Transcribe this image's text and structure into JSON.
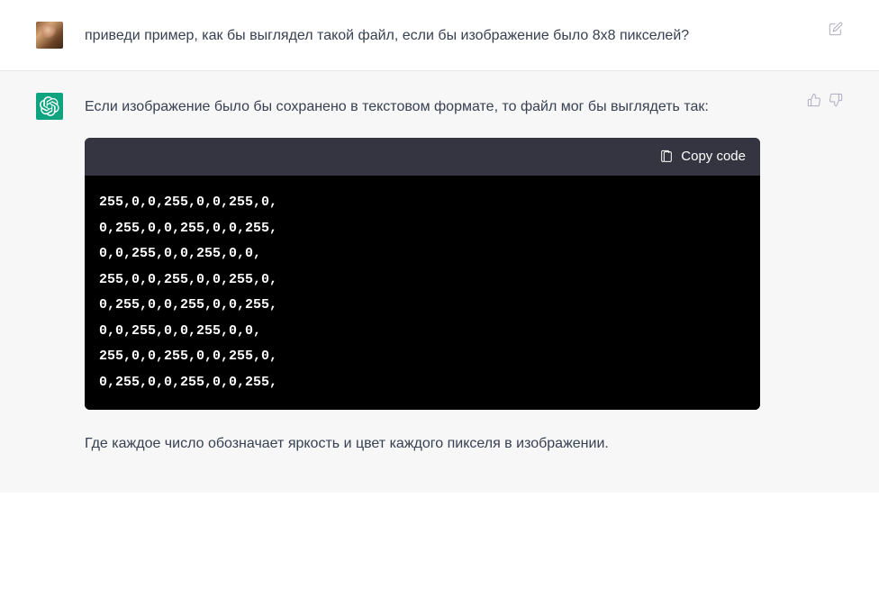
{
  "user_message": {
    "text": "приведи пример, как бы выглядел такой файл, если бы изображение было 8х8 пикселей?"
  },
  "assistant_message": {
    "intro_text": "Если изображение было бы сохранено в текстовом формате, то файл мог бы выглядеть так:",
    "copy_label": "Copy code",
    "code_lines": [
      "255,0,0,255,0,0,255,0,",
      "0,255,0,0,255,0,0,255,",
      "0,0,255,0,0,255,0,0,",
      "255,0,0,255,0,0,255,0,",
      "0,255,0,0,255,0,0,255,",
      "0,0,255,0,0,255,0,0,",
      "255,0,0,255,0,0,255,0,",
      "0,255,0,0,255,0,0,255,"
    ],
    "outro_text": "Где каждое число обозначает яркость и цвет каждого пикселя в изображении."
  }
}
